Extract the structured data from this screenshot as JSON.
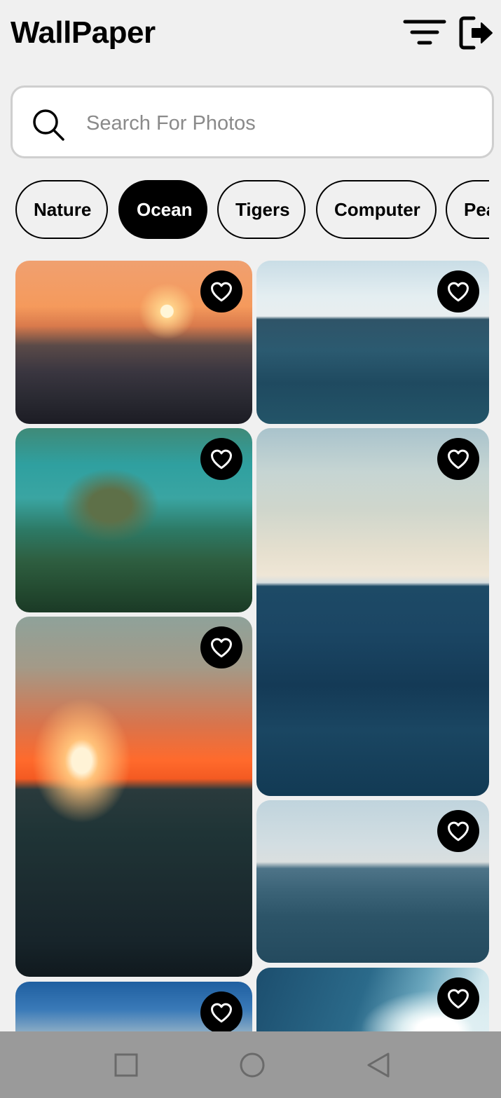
{
  "header": {
    "title": "WallPaper",
    "filter_icon": "filter-icon",
    "logout_icon": "logout-icon"
  },
  "search": {
    "placeholder": "Search For Photos",
    "value": "",
    "icon": "search-icon"
  },
  "categories": [
    {
      "label": "Nature",
      "active": false
    },
    {
      "label": "Ocean",
      "active": true
    },
    {
      "label": "Tigers",
      "active": false
    },
    {
      "label": "Computer",
      "active": false
    },
    {
      "label": "Pea",
      "active": false
    }
  ],
  "photos": [
    {
      "name": "photo-sunset-waves",
      "column": "left",
      "favorite_icon": "heart-outline-icon"
    },
    {
      "name": "photo-open-sea-horizon",
      "column": "right",
      "favorite_icon": "heart-outline-icon"
    },
    {
      "name": "photo-sea-turtle",
      "column": "left",
      "favorite_icon": "heart-outline-icon"
    },
    {
      "name": "photo-ocean-clouds-sky",
      "column": "right",
      "favorite_icon": "heart-outline-icon"
    },
    {
      "name": "photo-orange-sunset-sea",
      "column": "left",
      "favorite_icon": "heart-outline-icon"
    },
    {
      "name": "photo-calm-blue-water",
      "column": "right",
      "favorite_icon": "heart-outline-icon"
    },
    {
      "name": "photo-stormy-clouds",
      "column": "left",
      "favorite_icon": "heart-outline-icon"
    },
    {
      "name": "photo-ship-wake",
      "column": "right",
      "favorite_icon": "heart-outline-icon"
    }
  ],
  "navigation": {
    "recents_icon": "square-icon",
    "home_icon": "circle-icon",
    "back_icon": "triangle-back-icon"
  },
  "colors": {
    "background": "#f0f0f0",
    "accent": "#000000",
    "navbar": "#9a9a9a"
  }
}
